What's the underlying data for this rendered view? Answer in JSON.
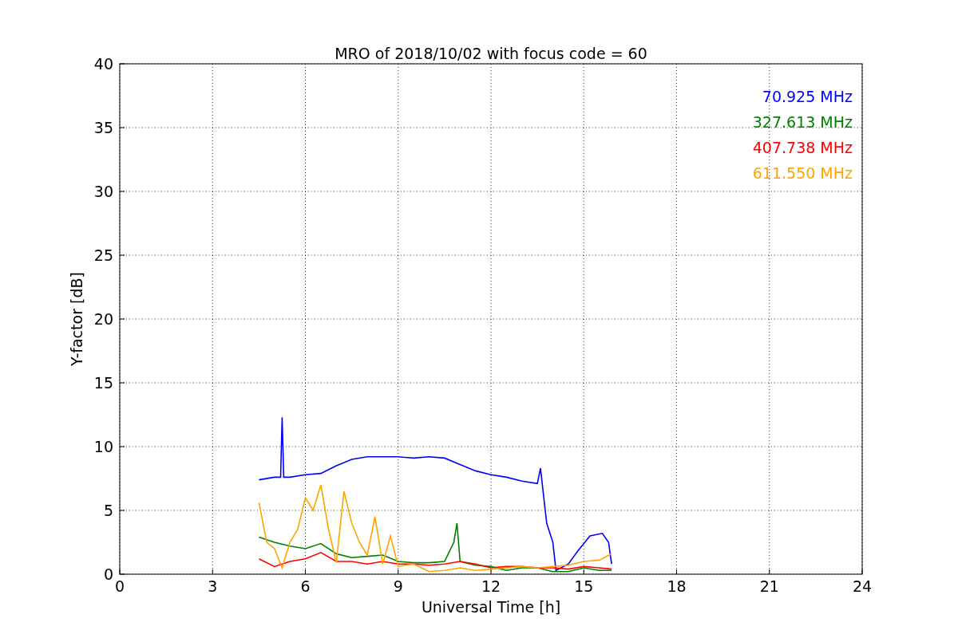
{
  "chart_data": {
    "type": "line",
    "title": "MRO of 2018/10/02 with focus code = 60",
    "xlabel": "Universal Time [h]",
    "ylabel": "Y-factor [dB]",
    "xlim": [
      0,
      24
    ],
    "ylim": [
      0,
      40
    ],
    "xticks": [
      0,
      3,
      6,
      9,
      12,
      15,
      18,
      21,
      24
    ],
    "yticks": [
      0,
      5,
      10,
      15,
      20,
      25,
      30,
      35,
      40
    ],
    "grid": true,
    "series": [
      {
        "name": "70.925 MHz",
        "color": "#0000ff",
        "x": [
          4.5,
          5,
          5.2,
          5.25,
          5.3,
          5.5,
          6,
          6.5,
          7,
          7.5,
          8,
          8.5,
          9,
          9.5,
          10,
          10.5,
          11,
          11.5,
          12,
          12.5,
          13,
          13.5,
          13.6,
          13.8,
          14.0,
          14.1,
          14.5,
          14.8,
          15.2,
          15.6,
          15.8,
          15.9
        ],
        "values": [
          7.4,
          7.6,
          7.6,
          12.3,
          7.6,
          7.6,
          7.8,
          7.9,
          8.5,
          9.0,
          9.2,
          9.2,
          9.2,
          9.1,
          9.2,
          9.1,
          8.6,
          8.1,
          7.8,
          7.6,
          7.3,
          7.1,
          8.3,
          4.0,
          2.5,
          0.3,
          0.8,
          1.8,
          3.0,
          3.2,
          2.5,
          0.8
        ]
      },
      {
        "name": "327.613 MHz",
        "color": "#008000",
        "x": [
          4.5,
          5,
          5.5,
          6,
          6.5,
          7,
          7.5,
          8,
          8.5,
          9,
          9.5,
          10,
          10.5,
          10.8,
          10.9,
          11,
          11.5,
          12,
          12.5,
          13,
          13.5,
          14,
          14.5,
          15,
          15.5,
          15.9
        ],
        "values": [
          2.9,
          2.5,
          2.2,
          2.0,
          2.4,
          1.6,
          1.3,
          1.4,
          1.5,
          1.0,
          0.9,
          0.9,
          1.0,
          2.5,
          4.0,
          1.0,
          0.7,
          0.6,
          0.3,
          0.5,
          0.5,
          0.2,
          0.2,
          0.5,
          0.3,
          0.3
        ]
      },
      {
        "name": "407.738 MHz",
        "color": "#ff0000",
        "x": [
          4.5,
          5,
          5.5,
          6,
          6.5,
          7,
          7.5,
          8,
          8.5,
          9,
          9.5,
          10,
          10.5,
          11,
          11.5,
          12,
          12.5,
          13,
          13.5,
          14,
          14.5,
          15,
          15.5,
          15.9
        ],
        "values": [
          1.2,
          0.6,
          1.0,
          1.2,
          1.7,
          1.0,
          1.0,
          0.8,
          1.0,
          0.8,
          0.8,
          0.7,
          0.8,
          1.0,
          0.8,
          0.5,
          0.6,
          0.6,
          0.5,
          0.5,
          0.4,
          0.6,
          0.5,
          0.4
        ]
      },
      {
        "name": "611.550 MHz",
        "color": "#ffa500",
        "x": [
          4.5,
          4.75,
          5,
          5.25,
          5.5,
          5.75,
          6,
          6.25,
          6.5,
          6.75,
          7,
          7.25,
          7.5,
          7.75,
          8,
          8.25,
          8.5,
          8.75,
          9,
          9.5,
          10,
          10.5,
          11,
          11.5,
          12,
          12.5,
          13,
          13.5,
          14,
          14.5,
          15,
          15.5,
          15.9
        ],
        "values": [
          5.6,
          2.5,
          2.0,
          0.5,
          2.5,
          3.5,
          6.0,
          5.0,
          7.0,
          3.5,
          0.9,
          6.5,
          4.0,
          2.5,
          1.5,
          4.5,
          0.8,
          3.0,
          0.6,
          0.8,
          0.2,
          0.3,
          0.5,
          0.3,
          0.4,
          0.5,
          0.6,
          0.5,
          0.6,
          0.7,
          1.0,
          1.1,
          1.6
        ]
      }
    ]
  }
}
